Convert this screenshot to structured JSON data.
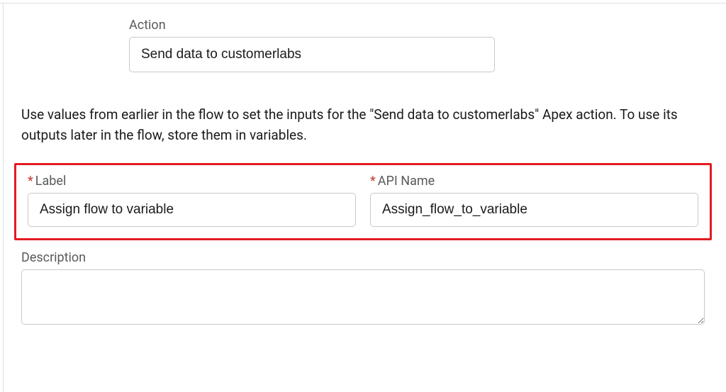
{
  "action": {
    "label": "Action",
    "value": "Send data to customerlabs"
  },
  "helper_text": "Use values from earlier in the flow to set the inputs for the \"Send data to customerlabs\" Apex action. To use its outputs later in the flow, store them in variables.",
  "label_field": {
    "label": "Label",
    "value": "Assign flow to variable",
    "required": true
  },
  "api_name_field": {
    "label": "API Name",
    "value": "Assign_flow_to_variable",
    "required": true
  },
  "description_field": {
    "label": "Description",
    "value": ""
  }
}
